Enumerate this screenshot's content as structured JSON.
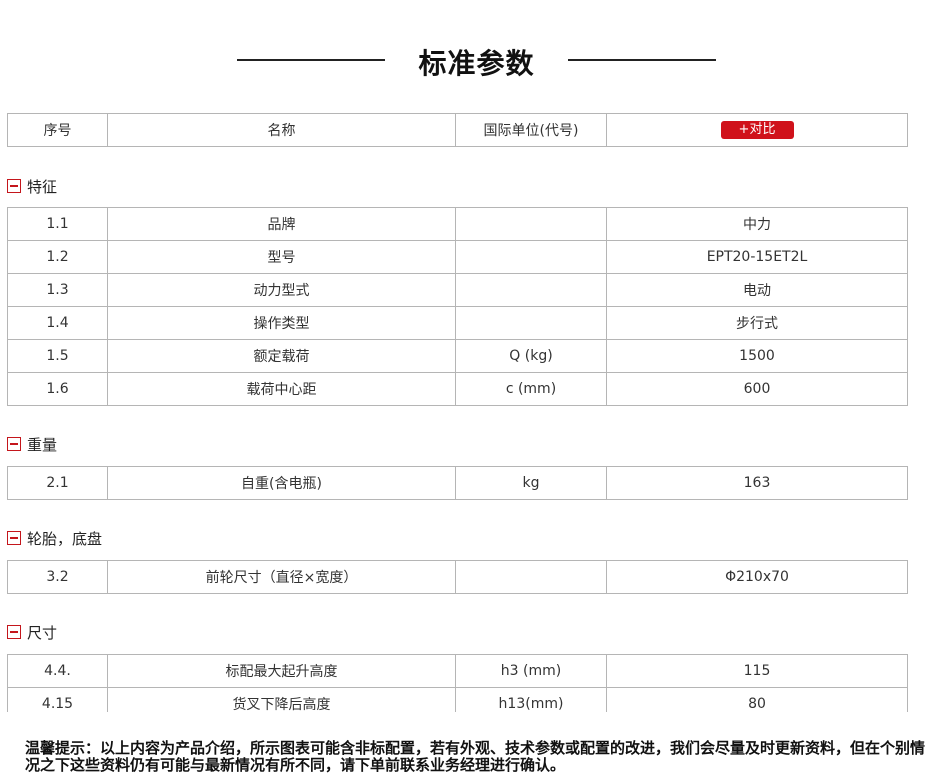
{
  "title": "标准参数",
  "header": {
    "col1": "序号",
    "col2": "名称",
    "col3": "国际单位(代号)",
    "compare_label": "+对比"
  },
  "sections": [
    {
      "name": "特征",
      "rows": [
        [
          "1.1",
          "品牌",
          "",
          "中力"
        ],
        [
          "1.2",
          "型号",
          "",
          "EPT20-15ET2L"
        ],
        [
          "1.3",
          "动力型式",
          "",
          "电动"
        ],
        [
          "1.4",
          "操作类型",
          "",
          "步行式"
        ],
        [
          "1.5",
          "额定载荷",
          "Q (kg)",
          "1500"
        ],
        [
          "1.6",
          "载荷中心距",
          "c (mm)",
          "600"
        ]
      ]
    },
    {
      "name": "重量",
      "rows": [
        [
          "2.1",
          "自重(含电瓶)",
          "kg",
          "163"
        ]
      ]
    },
    {
      "name": "轮胎，底盘",
      "rows": [
        [
          "3.2",
          "前轮尺寸（直径×宽度）",
          "",
          "Φ210x70"
        ]
      ]
    },
    {
      "name": "尺寸",
      "rows": [
        [
          "4.4.",
          "标配最大起升高度",
          "h3 (mm)",
          "115"
        ],
        [
          "4.15",
          "货叉下降后高度",
          "h13(mm)",
          "80"
        ]
      ]
    }
  ],
  "notice": "温馨提示：以上内容为产品介绍，所示图表可能含非标配置，若有外观、技术参数或配置的改进，我们会尽量及时更新资料，但在个别情况之下这些资料仍有可能与最新情况有所不同，请下单前联系业务经理进行确认。"
}
